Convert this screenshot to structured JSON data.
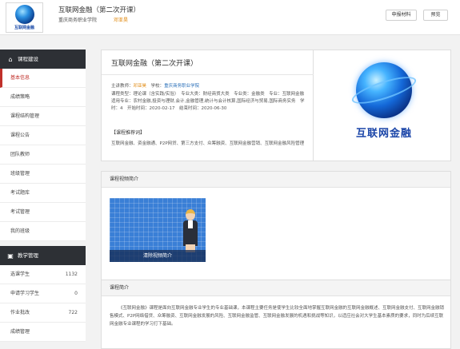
{
  "header": {
    "logo_text": "互联网金融",
    "course_title": "互联网金融（第二次开课）",
    "school": "重庆商务职业学院",
    "teacher": "邓亚昊",
    "apply_button": "申报材料",
    "preview_button": "预览"
  },
  "sidebar": {
    "section1_title": "课程建设",
    "section1_icon": "home-icon",
    "items": [
      {
        "label": "基本信息",
        "active": true
      },
      {
        "label": "成绩策略"
      },
      {
        "label": "课程结构管理"
      },
      {
        "label": "课程公告"
      },
      {
        "label": "团队教师"
      },
      {
        "label": "班级管理"
      },
      {
        "label": "考试题库"
      },
      {
        "label": "考试管理"
      },
      {
        "label": "我的班级"
      }
    ],
    "section2_title": "教学管理",
    "section2_icon": "clipboard-icon",
    "stats": [
      {
        "label": "选课学生",
        "count": "1132"
      },
      {
        "label": "申请学习学生",
        "count": "0"
      },
      {
        "label": "作业批改",
        "count": "722"
      },
      {
        "label": "成绩管理"
      }
    ]
  },
  "info": {
    "title": "互联网金融（第二次开课）",
    "teacher_label": "主讲教师：",
    "teacher_name": "邓亚昊",
    "school_label": "学校：",
    "school_name": "重庆商务职业学院",
    "meta_line": "课程类型：理论课（含实践/实验）　专业大类：财经商贸大类　专业类：金融类　专业：互联网金融　适用专业：农村金融,投资与理财,会计,金融管理,统计与会计核算,国际经济与贸易,国际商务实务　学时：4　开始时间：2020-02-17　结束时间：2020-06-30",
    "recommend_title": "【课程推荐词】",
    "recommend_text": "互联网金融、资金融通、P2P网贷、第三方支付、众筹融资、互联网金融营销、互联网金融风险管理",
    "cover_text": "互联网金融"
  },
  "video": {
    "panel_title": "课程视频简介",
    "caption": "清除视频简介"
  },
  "intro": {
    "panel_title": "课程简介",
    "text": "《互联网金融》课程是面向互联网金融专业学生的专业基础课，本课程主要任务是使学生比较全面地掌握互联网金融的互联网金融概述、互联网金融支付、互联网金融销售模式、P2P网络借贷、众筹融资、互联网金融发展的风险、互联网金融监管、互联网金融发展的机遇和挑战等知识，以适应社会对大学生基本素质的要求，同时为后续互联网金融专业课程的学习打下基础。"
  }
}
